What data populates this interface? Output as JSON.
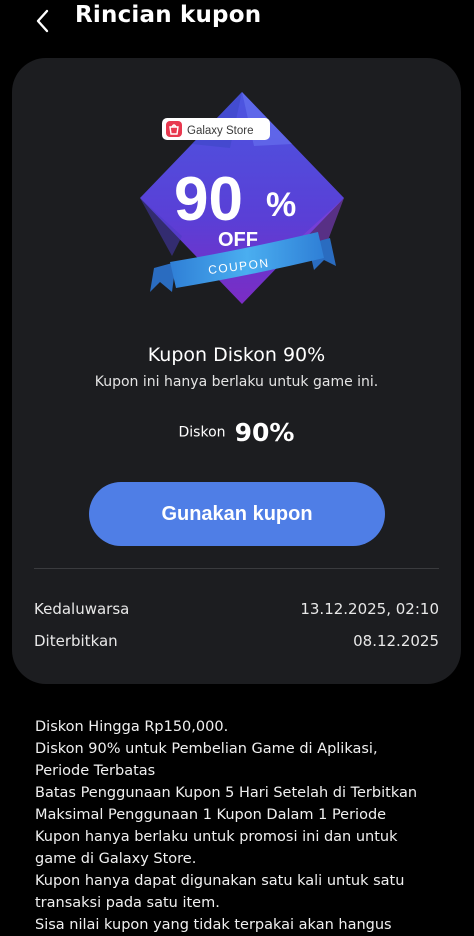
{
  "header": {
    "title": "Rincian kupon"
  },
  "coupon_art": {
    "store_label": "Galaxy Store",
    "big_value": "90",
    "percent": "%",
    "off": "OFF",
    "ribbon": "COUPON"
  },
  "coupon": {
    "name": "Kupon Diskon 90%",
    "description": "Kupon ini hanya berlaku untuk game ini.",
    "discount_label": "Diskon",
    "discount_value": "90%",
    "use_button": "Gunakan kupon"
  },
  "info": {
    "expiry_label": "Kedaluwarsa",
    "expiry_value": "13.12.2025, 02:10",
    "issued_label": "Diterbitkan",
    "issued_value": "08.12.2025"
  },
  "terms": [
    "Diskon Hingga Rp150,000.",
    "Diskon 90% untuk Pembelian Game di Aplikasi,",
    "Periode Terbatas",
    "Batas Penggunaan Kupon 5 Hari Setelah di Terbitkan",
    "Maksimal Penggunaan 1 Kupon Dalam 1 Periode",
    "Kupon hanya berlaku untuk promosi ini dan untuk",
    "game di Galaxy Store.",
    "Kupon hanya dapat digunakan satu kali untuk satu",
    "transaksi pada satu item.",
    "Sisa nilai kupon yang tidak terpakai akan hangus"
  ],
  "colors": {
    "background": "#000000",
    "card": "#1c1d20",
    "button": "#4f7ee6",
    "art_diamond_top": "#4a4fd8",
    "art_diamond_bottom": "#7a2fc9",
    "art_ribbon": "#3aa0e8",
    "store_badge": "#e8384f"
  },
  "icons": {
    "back": "chevron-left-icon",
    "store": "galaxy-store-bag-icon"
  }
}
